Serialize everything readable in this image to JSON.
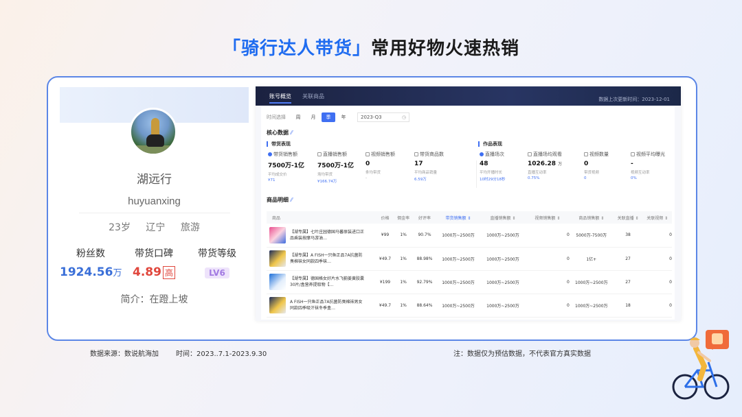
{
  "slide": {
    "title_highlight": "「骑行达人带货」",
    "title_rest": "常用好物火速热销"
  },
  "profile": {
    "name": "湖远行",
    "handle": "huyuanxing",
    "age": "23岁",
    "region": "辽宁",
    "category": "旅游",
    "fans_label": "粉丝数",
    "fans_value": "1924.56",
    "fans_unit": "万",
    "rating_label": "带货口碑",
    "rating_value": "4.89",
    "rating_badge": "高",
    "level_label": "带货等级",
    "level_value": "LV6",
    "bio": "简介：在蹬上坡"
  },
  "dashboard": {
    "tabs": [
      "账号概览",
      "关联商品"
    ],
    "updated": "数据上次更新时间：2023-12-01",
    "filter_label": "时间选择",
    "periods": [
      "周",
      "月",
      "季",
      "年"
    ],
    "active_period": "季",
    "date_value": "2023-Q3",
    "core_title": "核心数据",
    "sales_group": "带货表现",
    "works_group": "作品表现",
    "sales_metrics": [
      {
        "label": "带货销售额",
        "value": "7500万-1亿",
        "sub": "平均成交价",
        "sub2": "¥71"
      },
      {
        "label": "直播销售额",
        "value": "7500万-1亿",
        "sub": "场均带货",
        "sub2": "¥166.74万"
      },
      {
        "label": "视频销售额",
        "value": "0",
        "sub": "条均带货",
        "sub2": "-"
      },
      {
        "label": "带货商品数",
        "value": "17",
        "sub": "平均商品销量",
        "sub2": "6.59万"
      }
    ],
    "works_metrics": [
      {
        "label": "直播场次",
        "value": "48",
        "sub": "平均开播时长",
        "sub2": "10时29分18秒"
      },
      {
        "label": "直播场均观看",
        "value": "1026.28",
        "unit": "万",
        "sub": "直播互动率",
        "sub2": "0.75%"
      },
      {
        "label": "视频数量",
        "value": "0",
        "sub": "带货视频",
        "sub2": "0"
      },
      {
        "label": "视频平均曝光",
        "value": "-",
        "sub": "视频互动率",
        "sub2": "0%"
      }
    ],
    "product_title": "商品明细",
    "columns": [
      "商品",
      "价格",
      "佣金率",
      "好评率",
      "带货销售额 ⇕",
      "直播销售额 ⇕",
      "视频销售额 ⇕",
      "商品销售额 ⇕",
      "关联直播 ⇕",
      "关联视频 ⇕"
    ],
    "rows": [
      {
        "name": "【湖专属】七叶庄园德国马蕃原装进口正品乘装按摩马游油…",
        "price": "¥99",
        "commission": "1%",
        "praise": "90.7%",
        "total": "1000万~2500万",
        "live": "1000万~2500万",
        "video": "0",
        "product": "5000万-7500万",
        "live_count": "38",
        "video_count": "0"
      },
      {
        "name": "【湖专属】A FISH一只鱼正品7A抗菌防臭棉袜女同款四季袜…",
        "price": "¥49.7",
        "commission": "1%",
        "praise": "88.98%",
        "total": "1000万~2500万",
        "live": "1000万~2500万",
        "video": "0",
        "product": "1亿+",
        "live_count": "27",
        "video_count": "0"
      },
      {
        "name": "【湖专属】德国格女好片水飞蓟姜黄胶囊30片/盒营养提取物【…",
        "price": "¥199",
        "commission": "1%",
        "praise": "92.79%",
        "total": "1000万~2500万",
        "live": "1000万~2500万",
        "video": "0",
        "product": "1000万~2500万",
        "live_count": "27",
        "video_count": "0"
      },
      {
        "name": "A FISH一只鱼正品7A抗菌防臭棉袜男女同款四季吸汗袜冬季盒…",
        "price": "¥49.7",
        "commission": "1%",
        "praise": "88.64%",
        "total": "1000万~2500万",
        "live": "1000万~2500万",
        "video": "0",
        "product": "1000万~2500万",
        "live_count": "18",
        "video_count": "0"
      }
    ]
  },
  "footer": {
    "source": "数据来源：数说航海加",
    "time": "时间：2023..7.1-2023.9.30",
    "note": "注：数据仅为预估数据，不代表官方真实数据"
  }
}
